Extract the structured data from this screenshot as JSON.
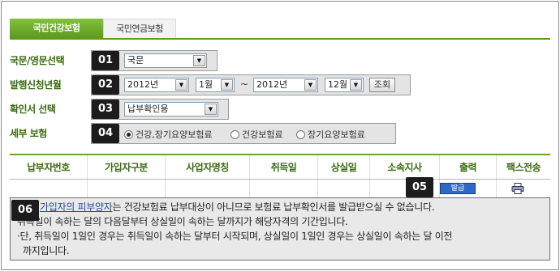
{
  "tabs": [
    {
      "label": "국민건강보험",
      "active": true
    },
    {
      "label": "국민연금보험",
      "active": false
    }
  ],
  "form": {
    "language": {
      "number": "01",
      "label": "국문/영문선택",
      "value": "국문"
    },
    "period": {
      "number": "02",
      "label": "발행신청년월",
      "from_year": "2012년",
      "from_month": "1월",
      "separator": "~",
      "to_year": "2012년",
      "to_month": "12월",
      "search_label": "조회"
    },
    "certificate": {
      "number": "03",
      "label": "확인서 선택",
      "value": "납부확인용"
    },
    "insurance": {
      "number": "04",
      "label": "세부 보험",
      "options": [
        {
          "label": "건강,장기요양보험료",
          "checked": true
        },
        {
          "label": "건강보험료",
          "checked": false
        },
        {
          "label": "장기요양보험료",
          "checked": false
        }
      ]
    }
  },
  "table": {
    "columns": [
      "납부자번호",
      "가입자구분",
      "사업자명칭",
      "취득일",
      "상실일",
      "소속지사",
      "출력",
      "팩스전송"
    ],
    "print_number": "05",
    "print_label": "발급",
    "fax_icon": "printer-icon"
  },
  "notes": {
    "number": "06",
    "line1_link": "가입자의 피부양자",
    "line1_rest": "는 건강보험료 납부대상이 아니므로 보험료 납부확인서를 발급받으실 수 없습니다.",
    "line2": "취득일이 속하는 달의 다음달부터 상실일이 속하는 달까지가 해당자격의 기간입니다.",
    "line3": "·단, 취득일이 1일인 경우는 취득일이 속하는 달부터 시작되며, 상실일이 1일인 경우는 상실일이 속하는 달 이전",
    "line4": "  까지입니다."
  }
}
